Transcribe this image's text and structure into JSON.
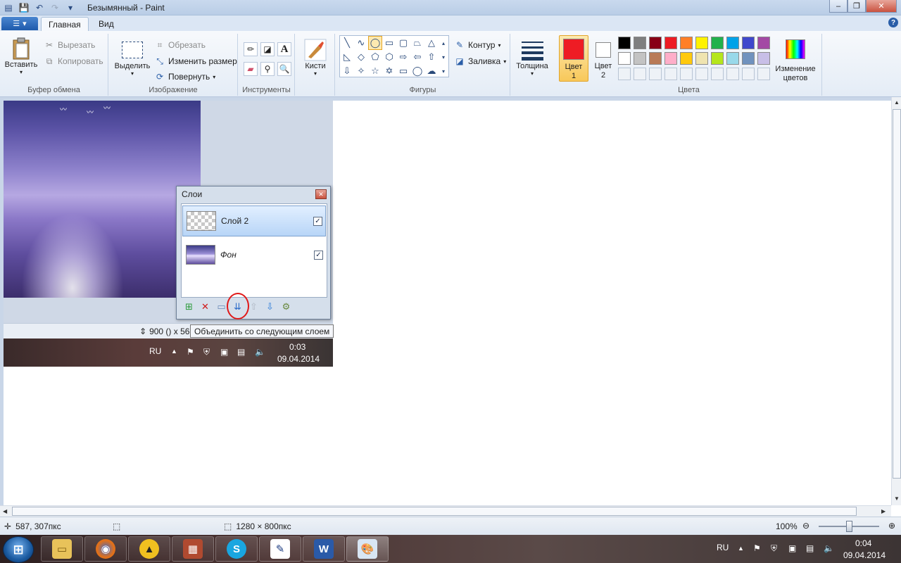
{
  "window": {
    "title": "Безымянный - Paint"
  },
  "tabs": {
    "file_icon": "menu-icon",
    "home": "Главная",
    "view": "Вид"
  },
  "ribbon": {
    "clipboard": {
      "paste": "Вставить",
      "cut": "Вырезать",
      "copy": "Копировать",
      "label": "Буфер обмена"
    },
    "image": {
      "select": "Выделить",
      "crop": "Обрезать",
      "resize": "Изменить размер",
      "rotate": "Повернуть",
      "label": "Изображение"
    },
    "tools": {
      "label": "Инструменты",
      "brushes": "Кисти"
    },
    "shapes": {
      "outline": "Контур",
      "fill": "Заливка",
      "label": "Фигуры"
    },
    "thickness": "Толщина",
    "colors": {
      "color1_a": "Цвет",
      "color1_b": "1",
      "color2_a": "Цвет",
      "color2_b": "2",
      "edit_a": "Изменение",
      "edit_b": "цветов",
      "label": "Цвета",
      "color1": "#ee1c24",
      "color2": "#ffffff",
      "palette": [
        "#000000",
        "#7f7f7f",
        "#880015",
        "#ed1c24",
        "#ff7f27",
        "#fff200",
        "#22b14c",
        "#00a2e8",
        "#3f48cc",
        "#a349a4",
        "#ffffff",
        "#c3c3c3",
        "#b97a57",
        "#ffaec9",
        "#ffc90e",
        "#efe4b0",
        "#b5e61d",
        "#99d9ea",
        "#7092be",
        "#c8bfe7"
      ]
    }
  },
  "screenshot": {
    "status_size": "900 () x 563",
    "tray_lang": "RU",
    "time": "0:03",
    "date": "09.04.2014"
  },
  "layers_panel": {
    "title": "Слои",
    "layers": [
      {
        "name": "Слой 2",
        "visible": true,
        "selected": true
      },
      {
        "name": "Фон",
        "visible": true,
        "selected": false
      }
    ],
    "tooltip": "Объединить со следующим слоем"
  },
  "statusbar": {
    "cursor": "587, 307пкс",
    "canvas_size": "1280 × 800пкс",
    "zoom": "100%"
  },
  "taskbar": {
    "lang": "RU",
    "time": "0:04",
    "date": "09.04.2014"
  }
}
